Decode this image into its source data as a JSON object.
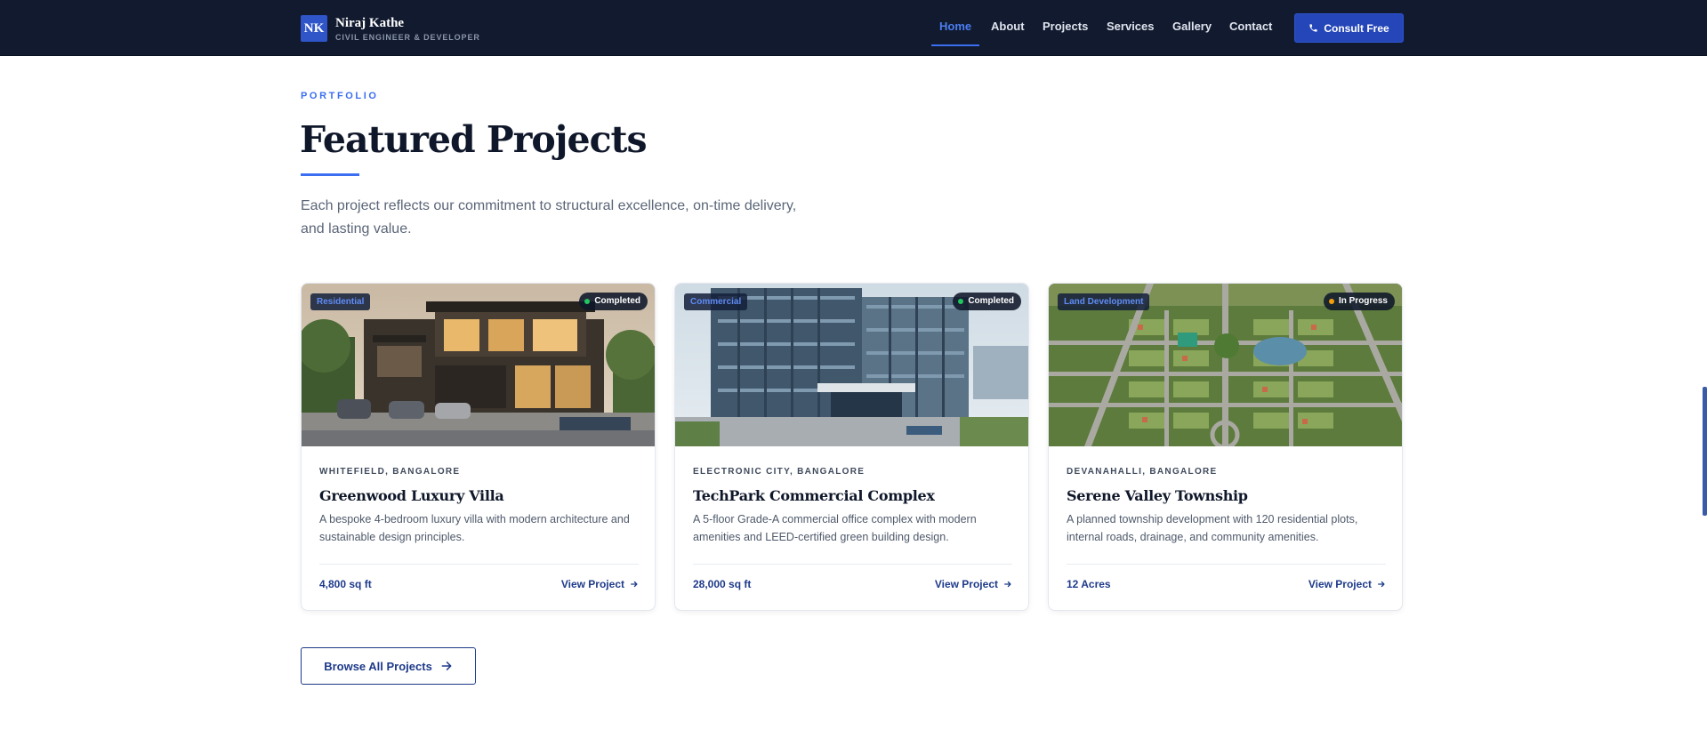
{
  "header": {
    "logo_initials": "NK",
    "brand_name": "Niraj Kathe",
    "brand_subtitle": "CIVIL ENGINEER & DEVELOPER",
    "nav": [
      {
        "label": "Home",
        "active": true
      },
      {
        "label": "About",
        "active": false
      },
      {
        "label": "Projects",
        "active": false
      },
      {
        "label": "Services",
        "active": false
      },
      {
        "label": "Gallery",
        "active": false
      },
      {
        "label": "Contact",
        "active": false
      }
    ],
    "cta_label": "Consult Free"
  },
  "section": {
    "eyebrow": "PORTFOLIO",
    "title": "Featured Projects",
    "lead": "Each project reflects our commitment to structural excellence, on-time delivery, and lasting value."
  },
  "projects": [
    {
      "category": "Residential",
      "status": "Completed",
      "status_color": "#22c55e",
      "location": "WHITEFIELD, BANGALORE",
      "title": "Greenwood Luxury Villa",
      "description": "A bespoke 4-bedroom luxury villa with modern architecture and sustainable design principles.",
      "area": "4,800 sq ft",
      "link_label": "View Project"
    },
    {
      "category": "Commercial",
      "status": "Completed",
      "status_color": "#22c55e",
      "location": "ELECTRONIC CITY, BANGALORE",
      "title": "TechPark Commercial Complex",
      "description": "A 5-floor Grade-A commercial office complex with modern amenities and LEED-certified green building design.",
      "area": "28,000 sq ft",
      "link_label": "View Project"
    },
    {
      "category": "Land Development",
      "status": "In Progress",
      "status_color": "#f59e0b",
      "location": "DEVANAHALLI, BANGALORE",
      "title": "Serene Valley Township",
      "description": "A planned township development with 120 residential plots, internal roads, drainage, and community amenities.",
      "area": "12 Acres",
      "link_label": "View Project"
    }
  ],
  "browse_label": "Browse All Projects",
  "colors": {
    "nav_bg": "#111a2e",
    "accent": "#3b6ef0",
    "cta_bg": "#2546b8",
    "link": "#1e3a8a"
  },
  "icons": {
    "cta": "phone-icon",
    "card_link": "arrow-right-icon",
    "browse": "arrow-right-icon"
  }
}
